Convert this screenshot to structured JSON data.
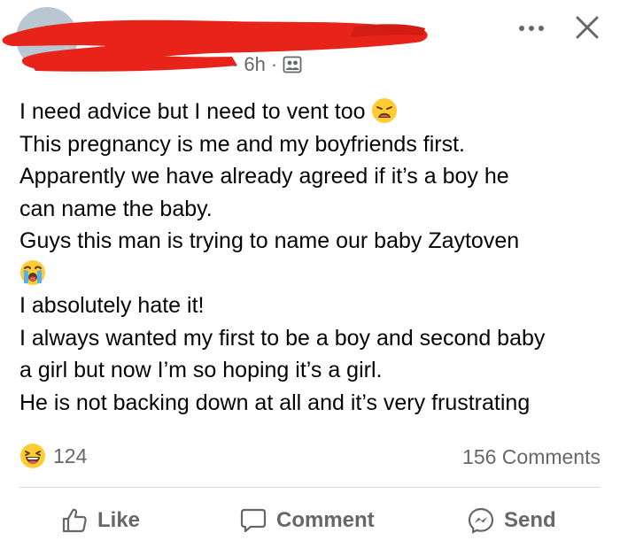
{
  "header": {
    "timestamp": "6h",
    "separator": "·",
    "privacy_icon": "group-members-icon",
    "more_icon": "more-dots-icon",
    "close_icon": "close-icon",
    "redaction_color": "#e8231a"
  },
  "post": {
    "lines": [
      "I need advice but I need to vent too",
      "This pregnancy is me and my boyfriends first.",
      "Apparently we have already agreed if it’s a boy he",
      "can name the baby.",
      "Guys this man is trying to name our baby Zaytoven",
      "I absolutely hate it!",
      "I always wanted my first to be a boy and second baby",
      "a girl but now I’m so hoping it’s a girl.",
      "He is not backing down at all and it’s very frustrating"
    ],
    "emoji_after_line_1": "weary-face-emoji",
    "emoji_after_line_5": "loudly-crying-face-emoji"
  },
  "engagement": {
    "reaction_icon": "laughing-face-reaction",
    "reaction_count": "124",
    "comments": "156 Comments"
  },
  "actions": {
    "like": "Like",
    "comment": "Comment",
    "send": "Send"
  },
  "colors": {
    "text": "#050505",
    "secondary": "#65676b",
    "divider": "#dadde1"
  }
}
